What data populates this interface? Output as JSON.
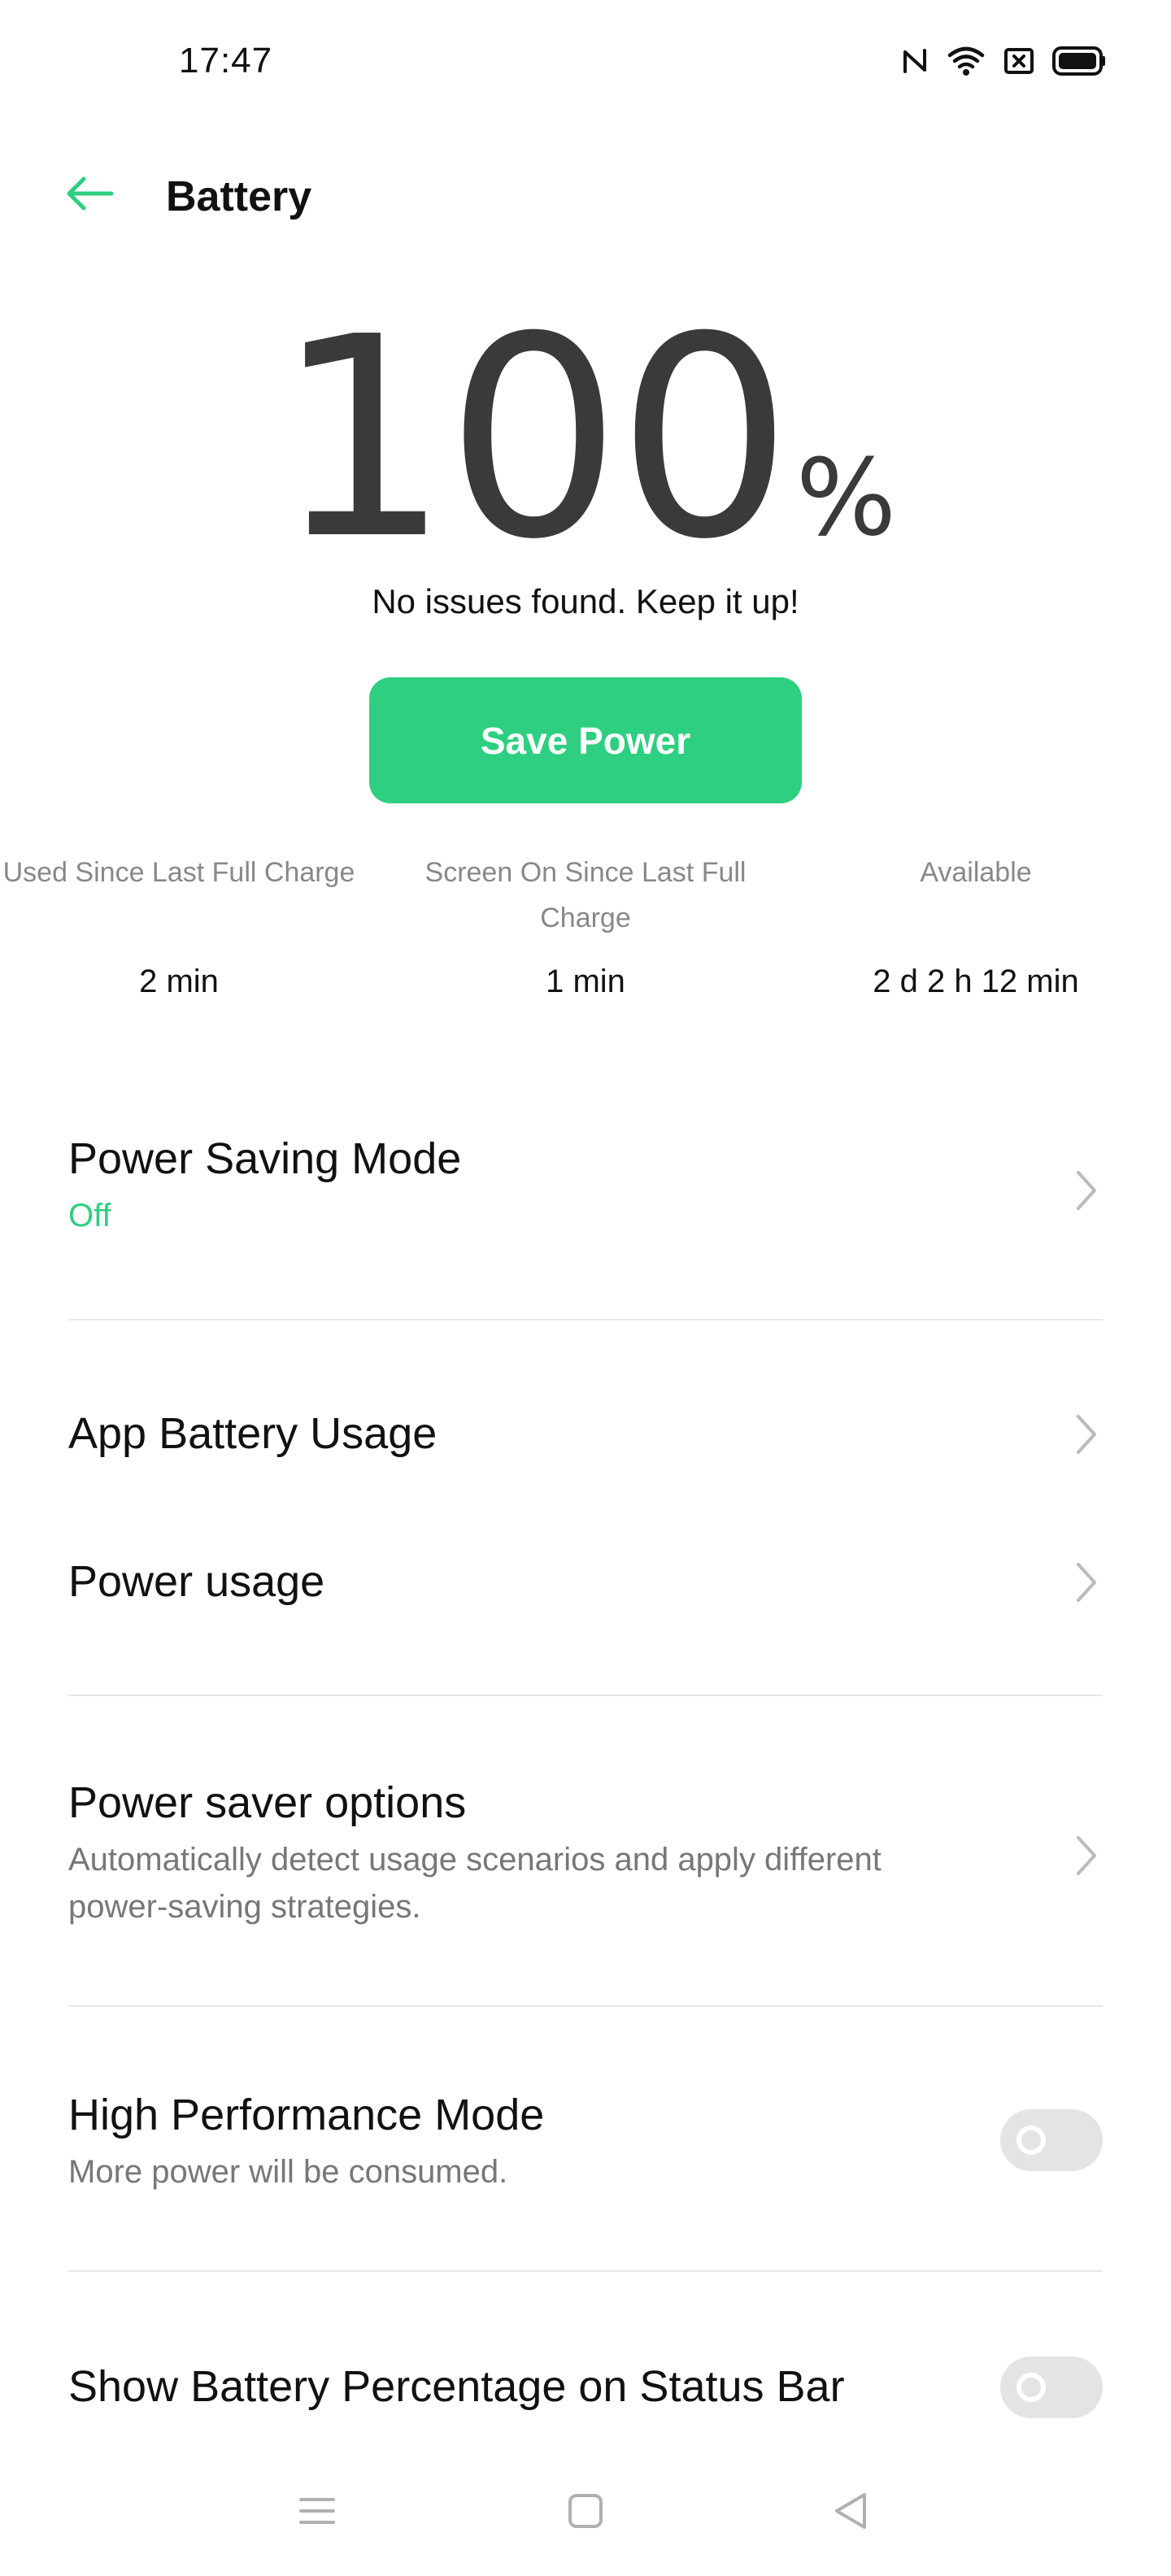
{
  "status_bar": {
    "time": "17:47",
    "icons": [
      "nfc-icon",
      "wifi-icon",
      "sim-off-icon",
      "battery-full-icon"
    ]
  },
  "header": {
    "title": "Battery",
    "back_icon": "arrow-left-icon"
  },
  "battery": {
    "level": 100,
    "level_text": "100",
    "percent_sign": "%",
    "message": "No issues found. Keep it up!",
    "save_button_label": "Save Power"
  },
  "stats": [
    {
      "label": "Used Since Last Full Charge",
      "value": "2 min"
    },
    {
      "label": "Screen On Since Last Full Charge",
      "value": "1 min"
    },
    {
      "label": "Available",
      "value": "2 d 2 h 12 min"
    }
  ],
  "settings": {
    "power_saving_mode": {
      "title": "Power Saving Mode",
      "value": "Off"
    },
    "app_battery_usage": {
      "title": "App Battery Usage"
    },
    "power_usage": {
      "title": "Power usage"
    },
    "power_saver_options": {
      "title": "Power saver options",
      "subtitle": "Automatically detect usage scenarios and apply different power-saving strategies."
    },
    "high_performance_mode": {
      "title": "High Performance Mode",
      "subtitle": "More power will be consumed.",
      "enabled": false
    },
    "show_battery_percentage": {
      "title": "Show Battery Percentage on Status Bar",
      "enabled": false
    }
  },
  "nav_bar": {
    "buttons": [
      "menu-icon",
      "home-icon",
      "back-triangle-icon"
    ]
  },
  "colors": {
    "accent": "#2ecf80",
    "text_primary": "#111111",
    "text_secondary": "#777777",
    "toggle_off": "#e4e4e4",
    "divider": "#e8e8e8"
  }
}
